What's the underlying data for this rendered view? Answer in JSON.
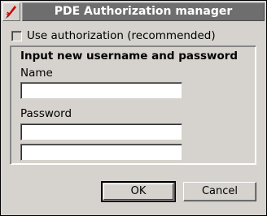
{
  "window": {
    "title": "PDE Authorization manager",
    "system_icon": "pen-icon",
    "accent_color": "#6e6e6e",
    "background_color": "#d6d3ce",
    "title_text_color": "#ffffff",
    "system_icon_color": "#cc0000"
  },
  "options": {
    "use_authorization_label": "Use authorization (recommended)",
    "use_authorization_checked": false
  },
  "credentials": {
    "group_title": "Input new username and password",
    "name_label": "Name",
    "name_value": "",
    "password_label": "Password",
    "password_value": "",
    "password_confirm_value": ""
  },
  "buttons": {
    "ok_label": "OK",
    "cancel_label": "Cancel"
  }
}
